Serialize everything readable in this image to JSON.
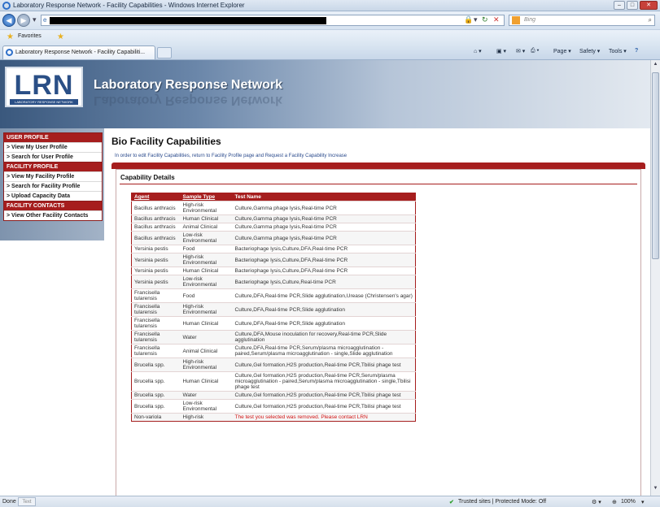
{
  "window": {
    "title": "Laboratory Response Network - Facility Capabilities - Windows Internet Explorer",
    "controls": [
      "–",
      "□",
      "✕"
    ]
  },
  "browser": {
    "search_placeholder": "Bing",
    "favorites_label": "Favorites",
    "tab_title": "Laboratory Response Network - Facility Capabiliti...",
    "commands": {
      "page": "Page ▾",
      "safety": "Safety ▾",
      "tools": "Tools ▾",
      "help": "?"
    }
  },
  "header": {
    "logo_text": "LRN",
    "logo_sub": "LABORATORY RESPONSE NETWORK",
    "brand": "Laboratory Response Network"
  },
  "sidebar": {
    "sections": [
      {
        "title": "USER PROFILE",
        "items": [
          "> View My User Profile",
          "> Search for User Profile"
        ]
      },
      {
        "title": "FACILITY PROFILE",
        "items": [
          "> View My Facility Profile",
          "> Search for Facility Profile",
          "> Upload Capacity Data"
        ]
      },
      {
        "title": "FACILITY CONTACTS",
        "items": [
          "> View Other Facility Contacts"
        ]
      }
    ]
  },
  "main": {
    "title": "Bio Facility Capabilities",
    "note": "In order to edit Facility Capabilities, return to Facility Profile page and Request a Facility Capability Increase",
    "panel_title": "Capability Details",
    "table": {
      "headers": [
        "Agent",
        "Sample Type",
        "Test Name"
      ],
      "rows": [
        [
          "Bacillus anthracis",
          "High-risk Environmental",
          "Culture,Gamma phage lysis,Real-time PCR"
        ],
        [
          "Bacillus anthracis",
          "Human Clinical",
          "Culture,Gamma phage lysis,Real-time PCR"
        ],
        [
          "Bacillus anthracis",
          "Animal Clinical",
          "Culture,Gamma phage lysis,Real-time PCR"
        ],
        [
          "Bacillus anthracis",
          "Low-risk Environmental",
          "Culture,Gamma phage lysis,Real-time PCR"
        ],
        [
          "Yersinia pestis",
          "Food",
          "Bacteriophage lysis,Culture,DFA,Real-time PCR"
        ],
        [
          "Yersinia pestis",
          "High-risk Environmental",
          "Bacteriophage lysis,Culture,DFA,Real-time PCR"
        ],
        [
          "Yersinia pestis",
          "Human Clinical",
          "Bacteriophage lysis,Culture,DFA,Real-time PCR"
        ],
        [
          "Yersinia pestis",
          "Low-risk Environmental",
          "Bacteriophage lysis,Culture,Real-time PCR"
        ],
        [
          "Francisella tularensis",
          "Food",
          "Culture,DFA,Real-time PCR,Slide agglutination,Urease (Christensen's agar)"
        ],
        [
          "Francisella tularensis",
          "High-risk Environmental",
          "Culture,DFA,Real-time PCR,Slide agglutination"
        ],
        [
          "Francisella tularensis",
          "Human Clinical",
          "Culture,DFA,Real-time PCR,Slide agglutination"
        ],
        [
          "Francisella tularensis",
          "Water",
          "Culture,DFA,Mouse inoculation for recovery,Real-time PCR,Slide agglutination"
        ],
        [
          "Francisella tularensis",
          "Animal Clinical",
          "Culture,DFA,Real-time PCR,Serum/plasma microagglutination - paired,Serum/plasma microagglutination - single,Slide agglutination"
        ],
        [
          "Brucella spp.",
          "High-risk Environmental",
          "Culture,Gel formation,H2S production,Real-time PCR,Tbilisi phage test"
        ],
        [
          "Brucella spp.",
          "Human Clinical",
          "Culture,Gel formation,H2S production,Real-time PCR,Serum/plasma microagglutination - paired,Serum/plasma microagglutination - single,Tbilisi phage test"
        ],
        [
          "Brucella spp.",
          "Water",
          "Culture,Gel formation,H2S production,Real-time PCR,Tbilisi phage test"
        ],
        [
          "Brucella spp.",
          "Low-risk Environmental",
          "Culture,Gel formation,H2S production,Real-time PCR,Tbilisi phage test"
        ],
        [
          "Non-variola",
          "High-risk",
          "The test you selected was removed. Please contact LRN"
        ]
      ]
    }
  },
  "statusbar": {
    "left": "Done",
    "box": "Text",
    "zone": "Trusted sites | Protected Mode: Off",
    "zoom": "100%"
  }
}
